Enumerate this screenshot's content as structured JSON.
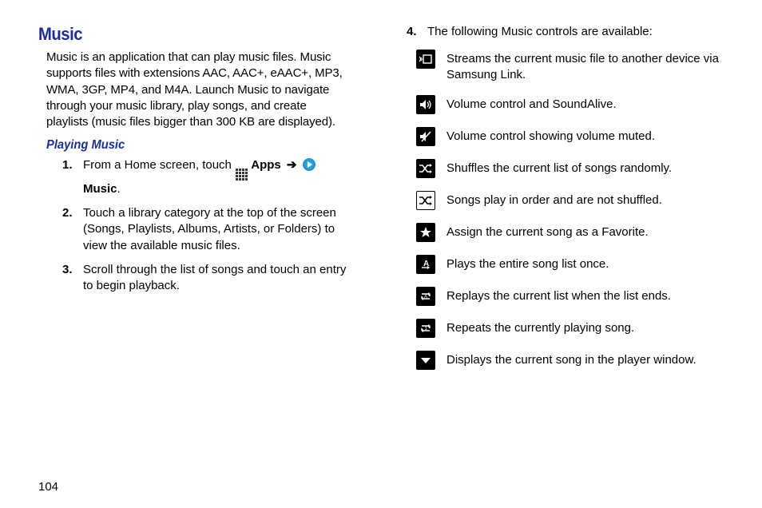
{
  "page_number": "104",
  "section_title": "Music",
  "intro_text": "Music is an application that can play music files. Music supports files with extensions AAC, AAC+, eAAC+, MP3, WMA, 3GP, MP4, and M4A. Launch Music to navigate through your music library, play songs, and create playlists (music files bigger than 300 KB are displayed).",
  "subsection_title": "Playing Music",
  "steps": {
    "s1_pre": "From a Home screen, touch ",
    "s1_apps": "Apps",
    "s1_music": "Music",
    "s1_post": ".",
    "s2": "Touch a library category at the top of the screen (Songs, Playlists, Albums, Artists, or Folders) to view the available music files.",
    "s3": "Scroll through the list of songs and touch an entry to begin playback.",
    "s4": "The following Music controls are available:"
  },
  "step_numbers": {
    "n1": "1.",
    "n2": "2.",
    "n3": "3.",
    "n4": "4."
  },
  "controls": [
    {
      "name": "stream-icon",
      "desc": "Streams the current music file to another device via Samsung Link."
    },
    {
      "name": "volume-icon",
      "desc": "Volume control and SoundAlive."
    },
    {
      "name": "mute-icon",
      "desc": "Volume control showing volume muted."
    },
    {
      "name": "shuffle-icon",
      "desc": "Shuffles the current list of songs randomly."
    },
    {
      "name": "no-shuffle-icon",
      "desc": "Songs play in order and are not shuffled."
    },
    {
      "name": "favorite-icon",
      "desc": "Assign the current song as a Favorite."
    },
    {
      "name": "play-once-icon",
      "desc": "Plays the entire song list once."
    },
    {
      "name": "repeat-all-icon",
      "desc": "Replays the current list when the list ends."
    },
    {
      "name": "repeat-one-icon",
      "desc": "Repeats the currently playing song."
    },
    {
      "name": "now-playing-icon",
      "desc": "Displays the current song in the player window."
    }
  ]
}
